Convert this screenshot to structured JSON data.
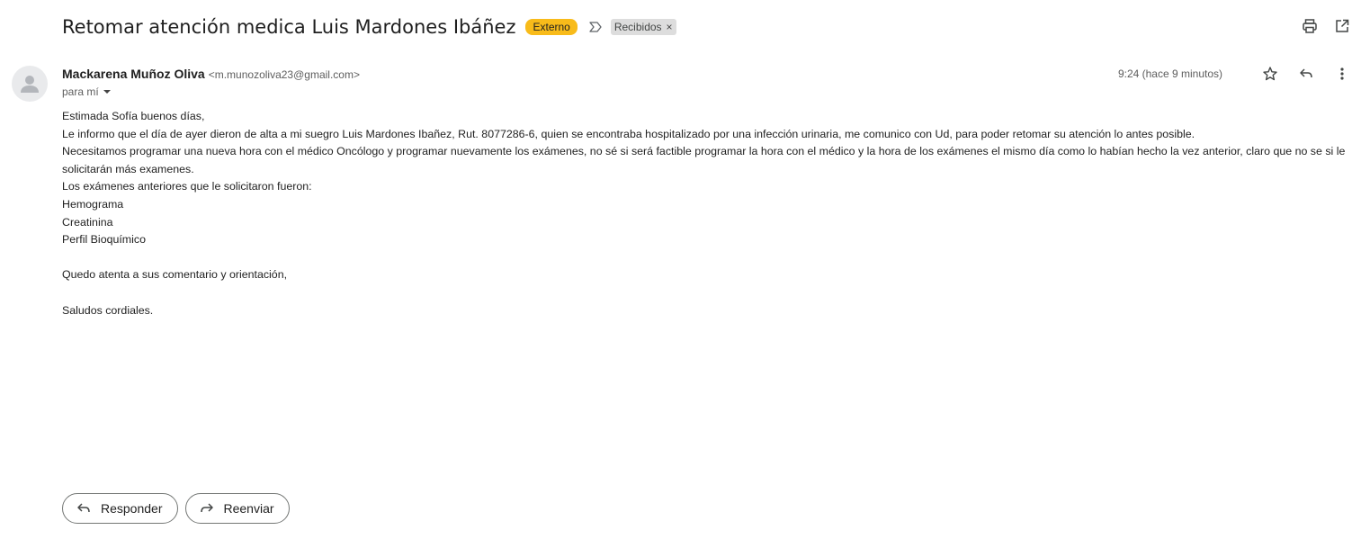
{
  "email": {
    "subject": "Retomar atención medica Luis Mardones Ibáñez",
    "badge": "Externo",
    "label": "Recibidos",
    "label_remove": "×",
    "sender_name": "Mackarena Muñoz Oliva",
    "sender_email": "<m.munozoliva23@gmail.com>",
    "recipient": "para mí",
    "timestamp": "9:24 (hace 9 minutos)",
    "body": [
      "Estimada Sofía buenos días,",
      "Le informo que el día de ayer dieron de alta  a mi suegro Luis Mardones Ibañez, Rut. 8077286-6, quien se encontraba hospitalizado por una infección urinaria, me comunico con Ud, para poder retomar su atención lo antes posible.",
      "Necesitamos programar una nueva hora con el médico Oncólogo y programar nuevamente los exámenes, no sé si será factible programar la hora con el médico y la hora de los exámenes el mismo día como lo habían hecho la vez anterior, claro que no se si le solicitarán más examenes.",
      "Los exámenes anteriores que le solicitaron fueron:",
      "Hemograma",
      "Creatinina",
      "Perfil Bioquímico",
      "",
      "Quedo atenta a sus comentario y orientación,",
      "",
      "Saludos cordiales."
    ]
  },
  "actions": {
    "reply_label": "Responder",
    "forward_label": "Reenviar"
  },
  "icons": {
    "print": "print-icon",
    "open_new_window": "open-in-new-window-icon",
    "star": "star-icon",
    "reply": "reply-icon",
    "more": "more-vert-icon",
    "important": "important-marker-icon",
    "avatar": "default-avatar-icon"
  },
  "colors": {
    "badge_external": "#f8bb1a",
    "label_chip": "#dddddd"
  }
}
